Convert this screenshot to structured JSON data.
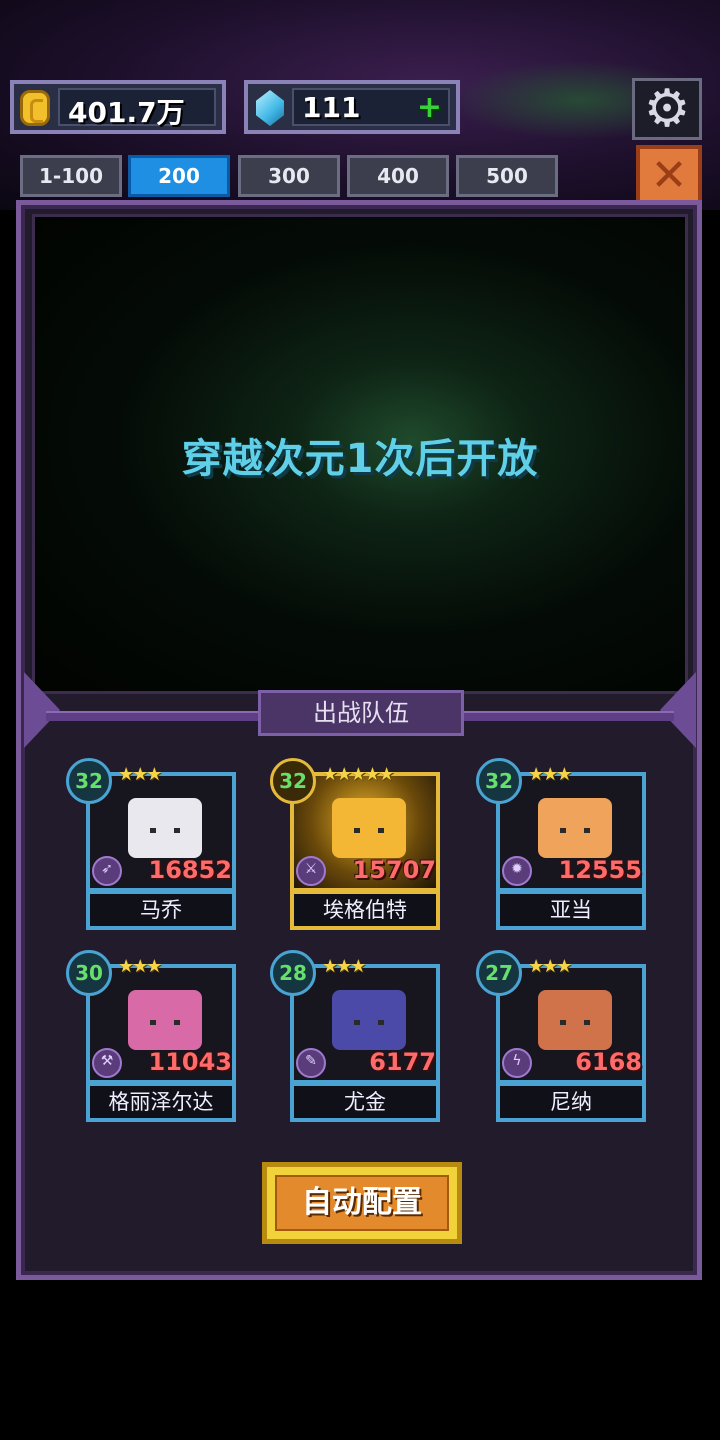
{
  "resources": {
    "gold_value": "401.7万",
    "gem_value": "111",
    "gem_add_label": "+"
  },
  "tabs": [
    {
      "label": "1-100",
      "active": false
    },
    {
      "label": "200",
      "active": true
    },
    {
      "label": "300",
      "active": false
    },
    {
      "label": "400",
      "active": false
    },
    {
      "label": "500",
      "active": false
    }
  ],
  "icons": {
    "settings": "gear-icon",
    "close": "close-icon",
    "gold": "coin-icon",
    "gem": "gem-icon"
  },
  "stage": {
    "locked_message": "穿越次元1次后开放"
  },
  "team": {
    "title": "出战队伍",
    "heroes": [
      {
        "name": "马乔",
        "level": "32",
        "stars": "★★★",
        "power": "16852",
        "rarity": "blue",
        "weapon_icon": "bow-icon"
      },
      {
        "name": "埃格伯特",
        "level": "32",
        "stars": "★★★★★",
        "power": "15707",
        "rarity": "gold",
        "weapon_icon": "crossed-swords-icon"
      },
      {
        "name": "亚当",
        "level": "32",
        "stars": "★★★",
        "power": "12555",
        "rarity": "blue",
        "weapon_icon": "fire-orb-icon"
      },
      {
        "name": "格丽泽尔达",
        "level": "30",
        "stars": "★★★",
        "power": "11043",
        "rarity": "blue",
        "weapon_icon": "axe-icon"
      },
      {
        "name": "尤金",
        "level": "28",
        "stars": "★★★",
        "power": "6177",
        "rarity": "blue",
        "weapon_icon": "feather-icon"
      },
      {
        "name": "尼纳",
        "level": "27",
        "stars": "★★★",
        "power": "6168",
        "rarity": "blue",
        "weapon_icon": "lightning-icon"
      }
    ]
  },
  "auto_button": {
    "label": "自动配置"
  },
  "colors": {
    "blue_frame": "#4aa3d2",
    "gold_frame": "#e5b93a",
    "power_text": "#ff6b6b",
    "level_text": "#66e06a",
    "lock_text": "#5fd0e8"
  }
}
